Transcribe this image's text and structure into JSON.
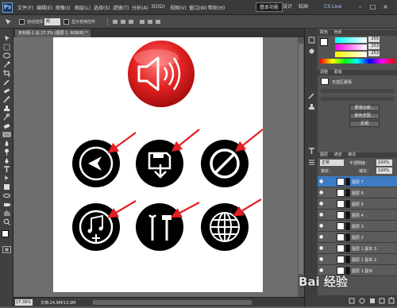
{
  "app": {
    "logo": "Ps",
    "zoom_top": "27.3",
    "right_label": "CS Live"
  },
  "menubar": {
    "items": [
      "文件(F)",
      "编辑(E)",
      "图像(I)",
      "图层(L)",
      "选择(S)",
      "滤镜(T)",
      "分析(A)",
      "3D(D)",
      "视图(V)",
      "窗口(W)",
      "帮助(H)"
    ]
  },
  "workspace": {
    "active": "基本功能",
    "items": [
      "设计",
      "绘画"
    ]
  },
  "window_controls": {
    "min": "–",
    "max": "□",
    "close": "×"
  },
  "options": {
    "auto_select_label": "自动选择：",
    "auto_select_value": "组",
    "show_transform_label": "显示变换控件"
  },
  "document": {
    "tab_title": "未标题-1 @ 27.3% (图层 1, RGB/8) *",
    "zoom": "27.39%",
    "doc_info": "文档:24.9M/13.9M"
  },
  "panels": {
    "color_tab": "颜色",
    "color_tab2": "色板",
    "color_values": [
      "255",
      "253",
      "253"
    ],
    "adjust_tab": "调整",
    "adjust_tab2": "蒙版",
    "mask_label": "无选区蒙版",
    "mask_buttons": [
      "蒙版边缘...",
      "颜色范围...",
      "反相"
    ],
    "layers_tab": "图层",
    "layers_tab2": "通道",
    "layers_tab3": "路径",
    "blend_mode": "正常",
    "opacity_label": "不透明度：",
    "opacity_value": "100%",
    "lock_label": "锁定：",
    "fill_label": "填充：",
    "fill_value": "100%",
    "layers": [
      "图层 7",
      "图层 6",
      "图层 5",
      "图层 4",
      "图层 3",
      "图层 2",
      "图层 1 副本 3",
      "图层 1 副本 2",
      "图层 1 副本"
    ]
  },
  "icons": {
    "big_icon": "speaker-icon",
    "circle_icons": [
      "back-arrow-icon",
      "save-download-icon",
      "prohibited-icon",
      "music-add-icon",
      "tools-icon",
      "globe-icon"
    ]
  },
  "colors": {
    "accent": "#e32222",
    "arrow": "#e31e24",
    "circle": "#000000"
  },
  "watermark": "Bai 经验"
}
